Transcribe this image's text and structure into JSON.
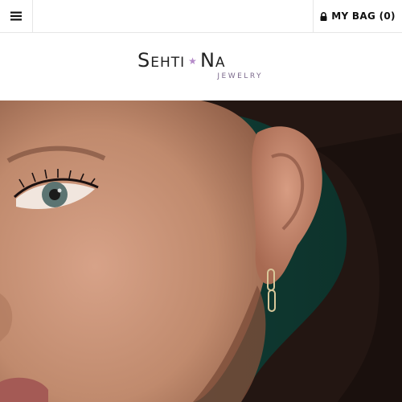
{
  "header": {
    "menu_icon": "hamburger-menu-icon",
    "lock_icon": "lock-icon",
    "bag_label": "MY BAG (0)"
  },
  "logo": {
    "word1": "Sehti",
    "word2": "Na",
    "star": "★",
    "tagline": "JEWELRY",
    "star_color": "#b58bc9"
  },
  "hero": {
    "description_colors": {
      "background": "#0f3b34",
      "skin": "#c99478",
      "hair": "#2a1c18"
    }
  }
}
